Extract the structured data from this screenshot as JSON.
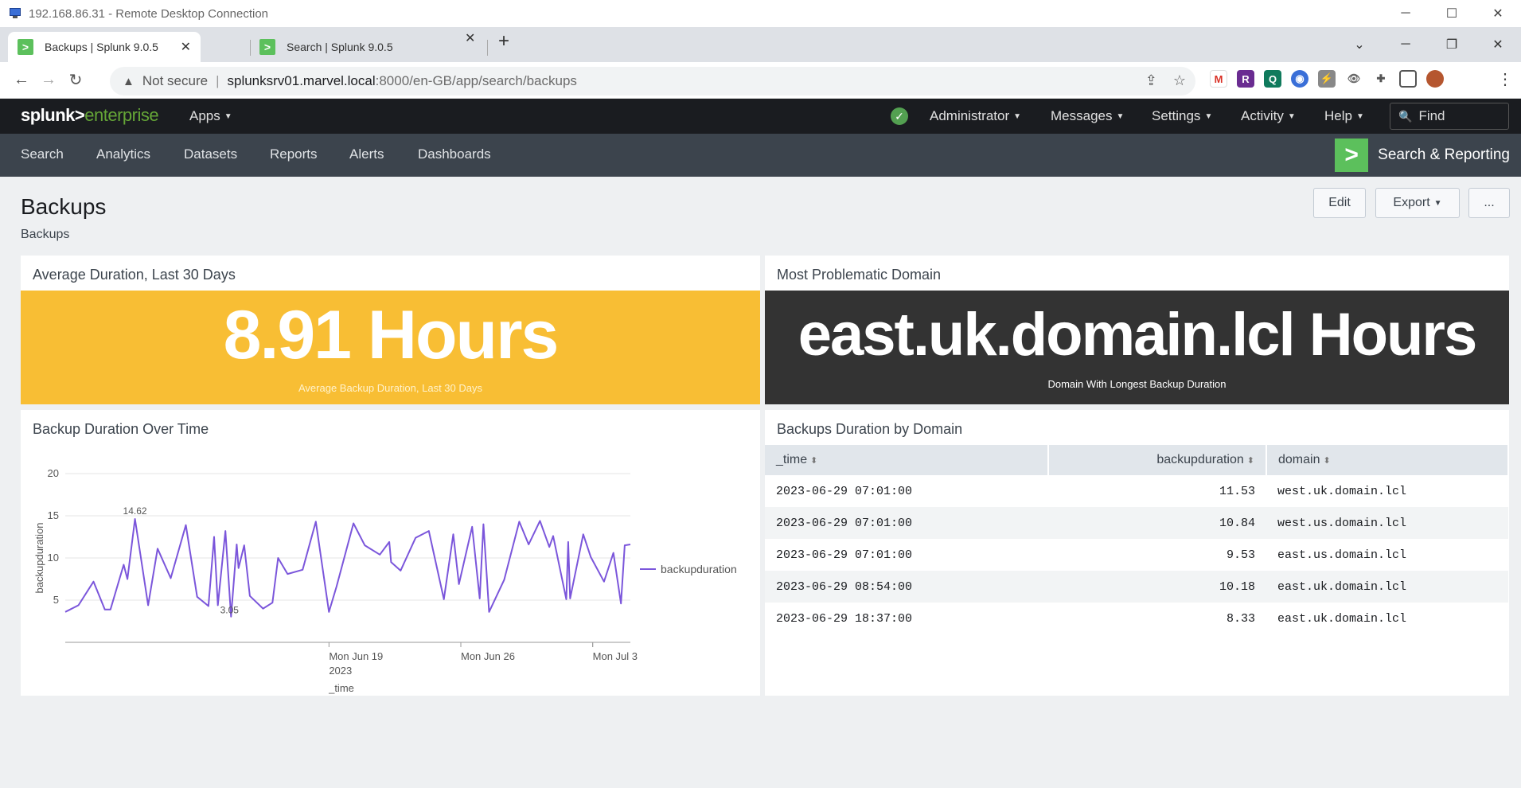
{
  "rdp": {
    "title": "192.168.86.31 - Remote Desktop Connection"
  },
  "browser": {
    "tabs": [
      {
        "label": "Backups | Splunk 9.0.5"
      },
      {
        "label": "Search | Splunk 9.0.5"
      }
    ],
    "address": {
      "warning": "Not secure",
      "host": "splunksrv01.marvel.local",
      "path": ":8000/en-GB/app/search/backups"
    }
  },
  "splunk": {
    "logo_main": "splunk>",
    "logo_sub": "enterprise",
    "apps": "Apps",
    "menu": [
      "Administrator",
      "Messages",
      "Settings",
      "Activity",
      "Help"
    ],
    "find_placeholder": "Find",
    "app_nav": [
      "Search",
      "Analytics",
      "Datasets",
      "Reports",
      "Alerts",
      "Dashboards"
    ],
    "app_name": "Search & Reporting"
  },
  "dashboard": {
    "title": "Backups",
    "subtitle": "Backups",
    "buttons": {
      "edit": "Edit",
      "export": "Export",
      "more": "..."
    }
  },
  "panels": {
    "avg": {
      "title": "Average Duration, Last 30 Days",
      "value": "8.91 Hours",
      "under": "Average Backup Duration, Last 30 Days",
      "color": "#f8be34"
    },
    "problem": {
      "title": "Most Problematic Domain",
      "value": "east.uk.domain.lcl Hours",
      "under": "Domain With Longest Backup Duration",
      "color": "#333333"
    },
    "chart": {
      "title": "Backup Duration Over Time"
    },
    "table": {
      "title": "Backups Duration by Domain",
      "columns": [
        "_time",
        "backupduration",
        "domain"
      ],
      "rows": [
        [
          "2023-06-29 07:01:00",
          "11.53",
          "west.uk.domain.lcl"
        ],
        [
          "2023-06-29 07:01:00",
          "10.84",
          "west.us.domain.lcl"
        ],
        [
          "2023-06-29 07:01:00",
          "9.53",
          "east.us.domain.lcl"
        ],
        [
          "2023-06-29 08:54:00",
          "10.18",
          "east.uk.domain.lcl"
        ],
        [
          "2023-06-29 18:37:00",
          "8.33",
          "east.uk.domain.lcl"
        ]
      ]
    }
  },
  "chart_data": {
    "type": "line",
    "title": "",
    "xlabel": "_time",
    "ylabel": "backupduration",
    "ylim": [
      0,
      20
    ],
    "yticks": [
      5,
      10,
      15,
      20
    ],
    "xticks": [
      {
        "day": 14,
        "label": "Mon Jun 19",
        "sublabel": "2023"
      },
      {
        "day": 21,
        "label": "Mon Jun 26",
        "sublabel": ""
      },
      {
        "day": 28,
        "label": "Mon Jul 3",
        "sublabel": ""
      }
    ],
    "xlim": [
      0,
      30
    ],
    "legend": "right",
    "annotations": {
      "max": "14.62",
      "min": "3.05"
    },
    "series": [
      {
        "name": "backupduration",
        "color": "#7b56db",
        "points": [
          [
            0.0,
            3.6
          ],
          [
            0.7,
            4.4
          ],
          [
            1.5,
            7.2
          ],
          [
            2.1,
            3.9
          ],
          [
            2.4,
            3.9
          ],
          [
            3.1,
            9.2
          ],
          [
            3.3,
            7.5
          ],
          [
            3.7,
            14.62
          ],
          [
            4.4,
            4.4
          ],
          [
            4.9,
            11.1
          ],
          [
            5.6,
            7.6
          ],
          [
            6.4,
            13.9
          ],
          [
            7.0,
            5.4
          ],
          [
            7.6,
            4.3
          ],
          [
            7.9,
            12.5
          ],
          [
            8.1,
            4.4
          ],
          [
            8.5,
            13.2
          ],
          [
            8.8,
            3.05
          ],
          [
            9.1,
            11.6
          ],
          [
            9.2,
            8.8
          ],
          [
            9.5,
            11.5
          ],
          [
            9.8,
            5.5
          ],
          [
            10.5,
            4.0
          ],
          [
            11.0,
            4.7
          ],
          [
            11.3,
            10.0
          ],
          [
            11.8,
            8.1
          ],
          [
            12.6,
            8.6
          ],
          [
            13.3,
            14.3
          ],
          [
            14.0,
            3.6
          ],
          [
            14.4,
            6.6
          ],
          [
            15.3,
            14.1
          ],
          [
            15.9,
            11.5
          ],
          [
            16.7,
            10.4
          ],
          [
            17.2,
            11.9
          ],
          [
            17.3,
            9.5
          ],
          [
            17.8,
            8.5
          ],
          [
            18.6,
            12.4
          ],
          [
            19.3,
            13.2
          ],
          [
            20.1,
            5.1
          ],
          [
            20.6,
            12.8
          ],
          [
            20.9,
            6.9
          ],
          [
            21.6,
            13.7
          ],
          [
            22.0,
            5.2
          ],
          [
            22.2,
            14.0
          ],
          [
            22.5,
            3.6
          ],
          [
            23.3,
            7.4
          ],
          [
            24.1,
            14.3
          ],
          [
            24.6,
            11.6
          ],
          [
            25.2,
            14.4
          ],
          [
            25.7,
            11.3
          ],
          [
            25.9,
            12.6
          ],
          [
            26.6,
            5.1
          ],
          [
            26.7,
            11.9
          ],
          [
            26.8,
            5.2
          ],
          [
            27.5,
            12.8
          ],
          [
            27.9,
            10.1
          ],
          [
            28.6,
            7.2
          ],
          [
            29.1,
            10.6
          ],
          [
            29.5,
            4.6
          ],
          [
            29.7,
            11.5
          ],
          [
            30.0,
            11.6
          ]
        ]
      }
    ]
  }
}
